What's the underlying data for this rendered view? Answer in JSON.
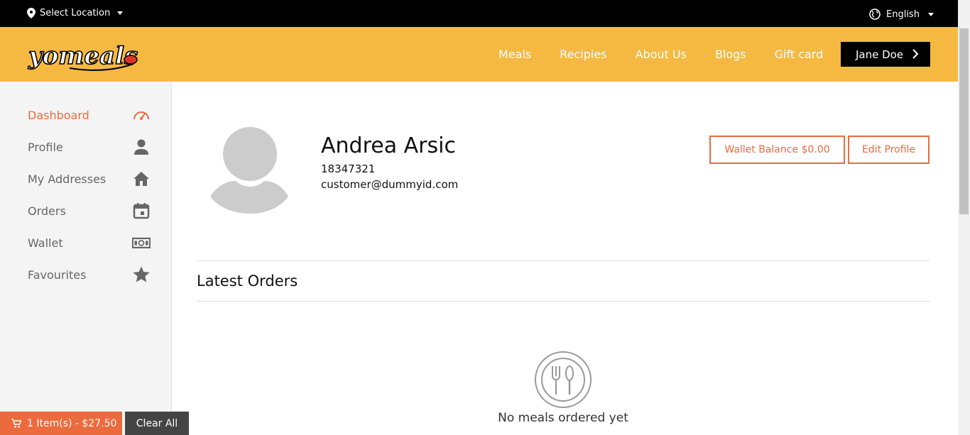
{
  "topbar": {
    "location_label": "Select Location",
    "language": "English"
  },
  "header": {
    "nav": [
      "Meals",
      "Recipies",
      "About Us",
      "Blogs",
      "Gift card"
    ],
    "user_name": "Jane Doe",
    "logo_text": "yomeals"
  },
  "sidebar": {
    "items": [
      {
        "label": "Dashboard",
        "icon": "speedometer-icon"
      },
      {
        "label": "Profile",
        "icon": "person-icon"
      },
      {
        "label": "My Addresses",
        "icon": "home-icon"
      },
      {
        "label": "Orders",
        "icon": "calendar-icon"
      },
      {
        "label": "Wallet",
        "icon": "money-icon"
      },
      {
        "label": "Favourites",
        "icon": "star-icon"
      }
    ]
  },
  "profile": {
    "name": "Andrea Arsic",
    "phone": "18347321",
    "email": "customer@dummyid.com",
    "wallet_button": "Wallet Balance $0.00",
    "edit_button": "Edit Profile"
  },
  "orders": {
    "title": "Latest Orders",
    "empty_text": "No meals ordered yet"
  },
  "cart": {
    "summary": "1 Item(s) - $27.50",
    "clear_label": "Clear All"
  },
  "colors": {
    "accent": "#ec6b3d",
    "header": "#f5b942",
    "topbar": "#000000"
  }
}
